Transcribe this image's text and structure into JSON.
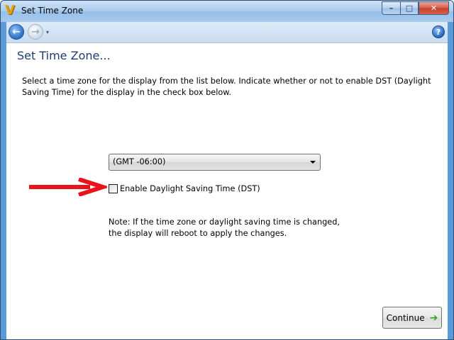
{
  "window": {
    "title": "Set Time Zone",
    "logo_letter": "V",
    "caption_minimize": "–",
    "caption_maximize": "□",
    "caption_close": "✕"
  },
  "nav": {
    "back_glyph": "←",
    "forward_glyph": "→",
    "dropdown_glyph": "▾",
    "help_glyph": "?"
  },
  "page": {
    "title": "Set Time Zone...",
    "instructions": "Select a time zone for the display from the list below. Indicate whether or not to enable DST (Daylight Saving Time) for the display in the check box below."
  },
  "timezone_select": {
    "selected_value": "(GMT -06:00)"
  },
  "dst": {
    "label": "Enable Daylight Saving Time (DST)",
    "checked": false
  },
  "note": "Note: If the time zone or daylight saving time is changed, the display will reboot to apply the changes.",
  "footer": {
    "continue_label": "Continue",
    "continue_icon": "➔"
  },
  "colors": {
    "accent_arrow": "#e8131b",
    "title_text": "#1e3d73",
    "continue_icon": "#2fa21a"
  }
}
